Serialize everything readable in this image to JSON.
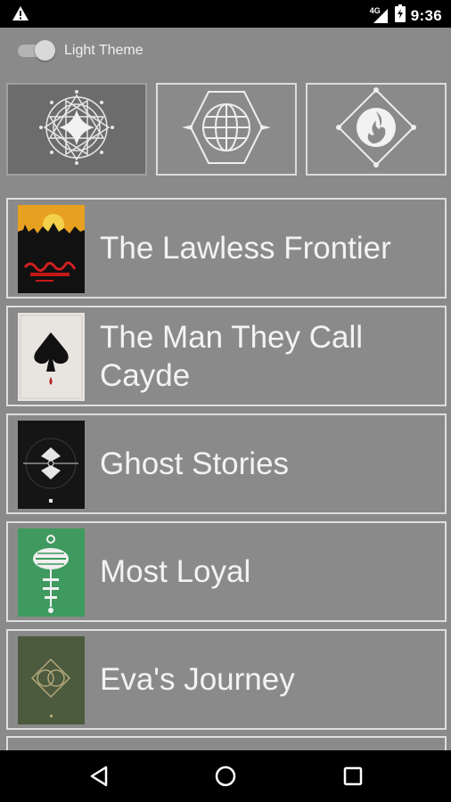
{
  "status_bar": {
    "time": "9:36",
    "network": "4G",
    "icons": [
      "warning-icon",
      "signal-icon",
      "battery-icon"
    ]
  },
  "theme_toggle": {
    "label": "Light Theme",
    "on": false
  },
  "class_tabs": [
    {
      "name": "hunter",
      "icon": "hunter-emblem-icon",
      "selected": true
    },
    {
      "name": "titan",
      "icon": "titan-emblem-icon",
      "selected": false
    },
    {
      "name": "warlock",
      "icon": "warlock-emblem-icon",
      "selected": false
    }
  ],
  "books": [
    {
      "title": "The Lawless Frontier",
      "cover": "lawless-frontier-cover"
    },
    {
      "title": "The Man They Call Cayde",
      "cover": "cayde-cover"
    },
    {
      "title": "Ghost Stories",
      "cover": "ghost-stories-cover"
    },
    {
      "title": "Most Loyal",
      "cover": "most-loyal-cover"
    },
    {
      "title": "Eva's Journey",
      "cover": "evas-journey-cover"
    }
  ],
  "nav_bar": {
    "buttons": [
      "back-icon",
      "home-icon",
      "recents-icon"
    ]
  },
  "colors": {
    "background": "#8a8a8a",
    "border": "#dedede",
    "selected_tab": "#6c6c6c",
    "text": "#f3f3f3"
  }
}
